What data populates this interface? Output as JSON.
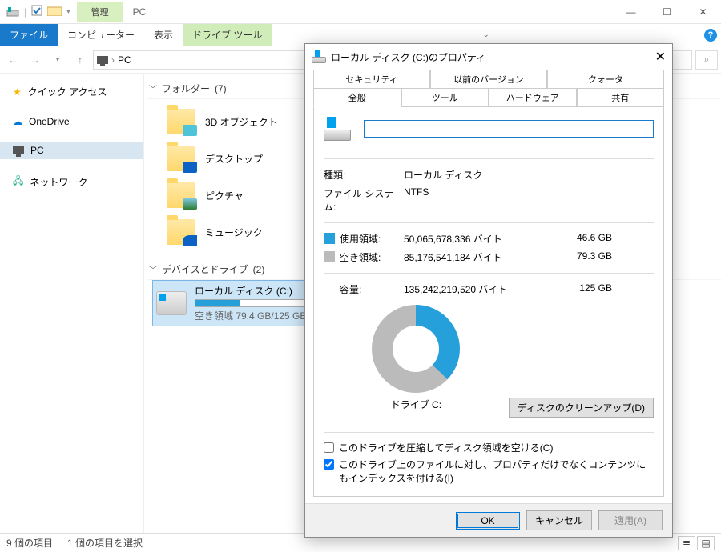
{
  "titlebar": {
    "contextual_label": "管理",
    "title": "PC"
  },
  "ribbon": {
    "file": "ファイル",
    "tabs": [
      "コンピューター",
      "表示"
    ],
    "contextual_tab": "ドライブ ツール",
    "expand_tip": "リボンの展開"
  },
  "nav": {
    "breadcrumb_root": "PC",
    "chev": "›"
  },
  "sidebar": {
    "items": [
      {
        "label": "クイック アクセス",
        "icon": "star"
      },
      {
        "label": "OneDrive",
        "icon": "cloud"
      },
      {
        "label": "PC",
        "icon": "pc",
        "selected": true
      },
      {
        "label": "ネットワーク",
        "icon": "net"
      }
    ]
  },
  "sections": {
    "folders": {
      "label": "フォルダー",
      "count": "(7)"
    },
    "drives": {
      "label": "デバイスとドライブ",
      "count": "(2)"
    }
  },
  "folders": [
    {
      "label": "3D オブジェクト"
    },
    {
      "label": "デスクトップ"
    },
    {
      "label": "ピクチャ"
    },
    {
      "label": "ミュージック"
    }
  ],
  "drives": [
    {
      "label": "ローカル ディスク (C:)",
      "sub": "空き領域 79.4 GB/125 GB",
      "fill_pct": 37
    }
  ],
  "status": {
    "items": "9 個の項目",
    "selected": "1 個の項目を選択"
  },
  "dialog": {
    "title": "ローカル ディスク (C:)のプロパティ",
    "tabs_row1": [
      "セキュリティ",
      "以前のバージョン",
      "クォータ"
    ],
    "tabs_row2": [
      "全般",
      "ツール",
      "ハードウェア",
      "共有"
    ],
    "active_tab": "全般",
    "name_value": "",
    "fields": {
      "type_label": "種類:",
      "type_value": "ローカル ディスク",
      "fs_label": "ファイル システム:",
      "fs_value": "NTFS",
      "used_label": "使用領域:",
      "used_bytes": "50,065,678,336 バイト",
      "used_h": "46.6 GB",
      "free_label": "空き領域:",
      "free_bytes": "85,176,541,184 バイト",
      "free_h": "79.3 GB",
      "cap_label": "容量:",
      "cap_bytes": "135,242,219,520 バイト",
      "cap_h": "125 GB"
    },
    "pie_caption": "ドライブ C:",
    "cleanup_btn": "ディスクのクリーンアップ(D)",
    "chk1": "このドライブを圧縮してディスク領域を空ける(C)",
    "chk2": "このドライブ上のファイルに対し、プロパティだけでなくコンテンツにもインデックスを付ける(I)",
    "chk2_checked": true,
    "buttons": {
      "ok": "OK",
      "cancel": "キャンセル",
      "apply": "適用(A)"
    },
    "colors": {
      "used": "#26a0da",
      "free": "#bbbbbb"
    }
  },
  "chart_data": {
    "type": "pie",
    "title": "ドライブ C:",
    "series": [
      {
        "name": "使用領域",
        "value_bytes": 50065678336,
        "value_gb": 46.6,
        "color": "#26a0da"
      },
      {
        "name": "空き領域",
        "value_bytes": 85176541184,
        "value_gb": 79.3,
        "color": "#bbbbbb"
      }
    ],
    "total_bytes": 135242219520,
    "total_gb": 125
  }
}
